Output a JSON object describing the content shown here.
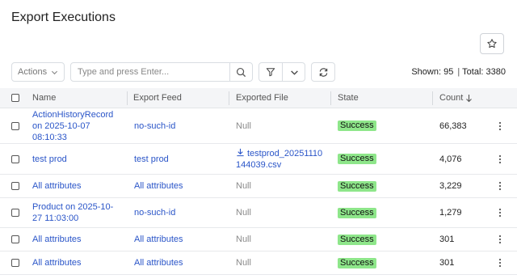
{
  "page": {
    "title": "Export Executions"
  },
  "toolbar": {
    "actions_label": "Actions",
    "search_placeholder": "Type and press Enter...",
    "shown_label": "Shown: 95",
    "total_label": "Total: 3380",
    "separator": "|"
  },
  "table": {
    "columns": [
      "Name",
      "Export Feed",
      "Exported File",
      "State",
      "Count"
    ],
    "sort": {
      "column": "Count",
      "direction": "descending"
    },
    "rows": [
      {
        "name": "ActionHistoryRecord on 2025-10-07 08:10:33",
        "feed": "no-such-id",
        "file": "Null",
        "file_is_link": false,
        "state": "Success",
        "count": "66,383"
      },
      {
        "name": "test prod",
        "feed": "test prod",
        "file": "testprod_20251110144039.csv",
        "file_is_link": true,
        "state": "Success",
        "count": "4,076"
      },
      {
        "name": "All attributes",
        "feed": "All attributes",
        "file": "Null",
        "file_is_link": false,
        "state": "Success",
        "count": "3,229"
      },
      {
        "name": "Product on 2025-10-27 11:03:00",
        "feed": "no-such-id",
        "file": "Null",
        "file_is_link": false,
        "state": "Success",
        "count": "1,279"
      },
      {
        "name": "All attributes",
        "feed": "All attributes",
        "file": "Null",
        "file_is_link": false,
        "state": "Success",
        "count": "301"
      },
      {
        "name": "All attributes",
        "feed": "All attributes",
        "file": "Null",
        "file_is_link": false,
        "state": "Success",
        "count": "301"
      }
    ]
  },
  "icons": {
    "star": "star-icon",
    "search": "search-icon",
    "filter": "filter-icon",
    "chevron": "chevron-down-icon",
    "refresh": "refresh-icon",
    "sort": "arrow-down-icon",
    "download": "download-icon",
    "menu": "kebab-menu-icon"
  },
  "colors": {
    "link": "#2a55c8",
    "success_badge": "#8ee68a",
    "header_bg": "#f4f5f7"
  }
}
